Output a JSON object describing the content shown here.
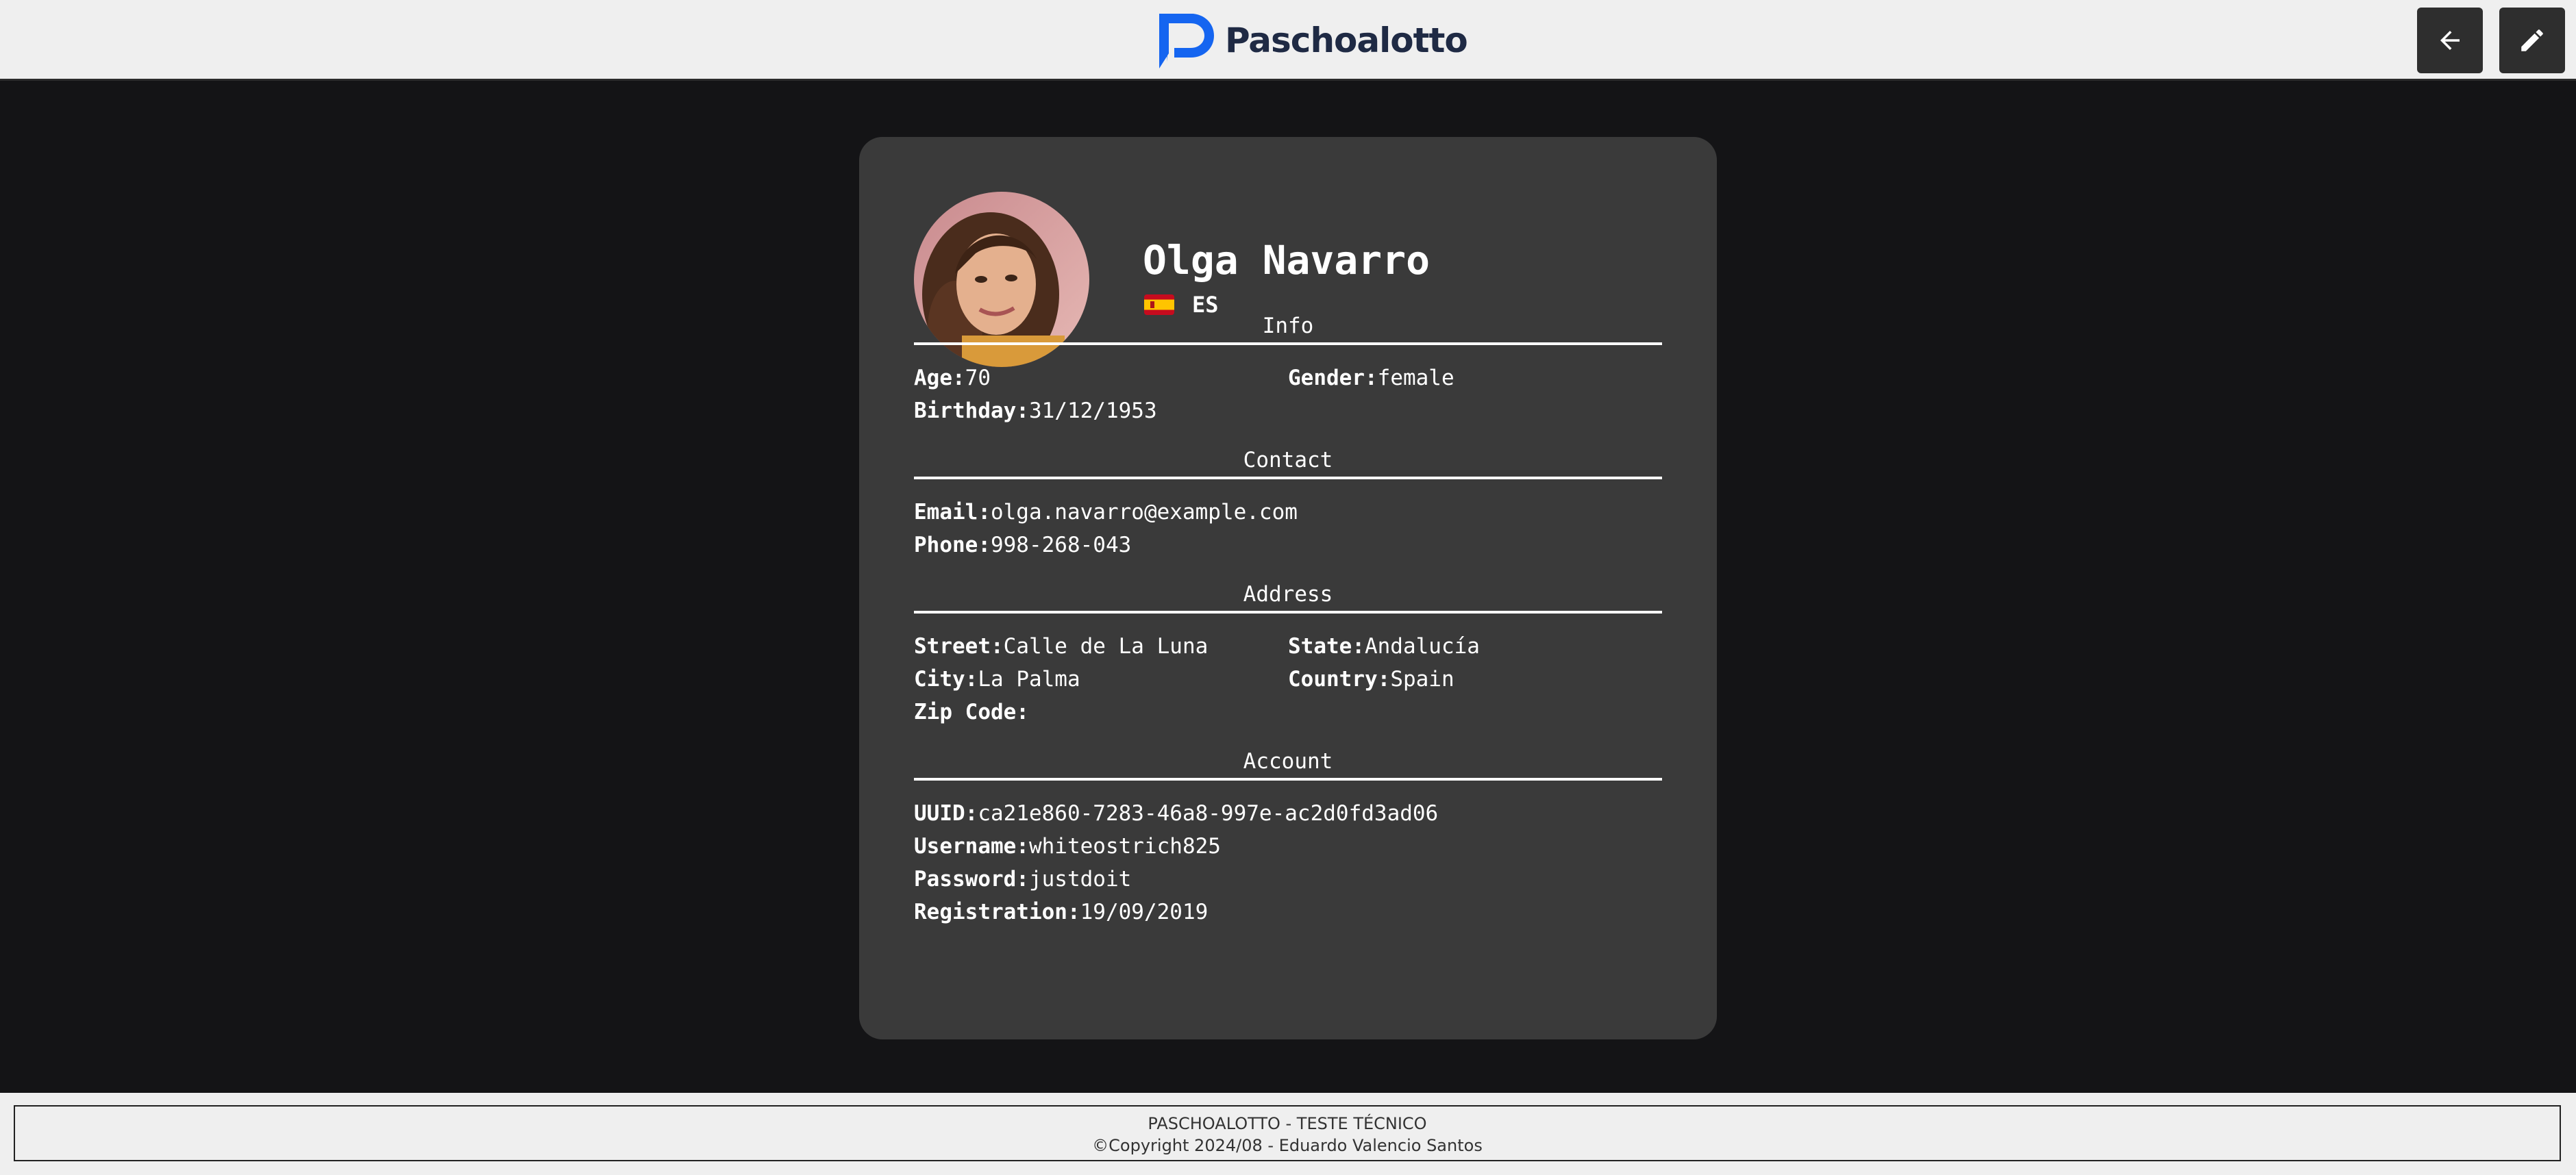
{
  "header": {
    "brand": "Paschoalotto",
    "brand_color": "#1565f0",
    "back_icon": "arrow-left-icon",
    "edit_icon": "pencil-icon"
  },
  "profile": {
    "name": "Olga Navarro",
    "nationality": "ES",
    "flag": "spain-flag-icon",
    "sections": {
      "info": {
        "title": "Info",
        "age_label": "Age:",
        "age": "70",
        "gender_label": "Gender:",
        "gender": "female",
        "birthday_label": "Birthday:",
        "birthday": "31/12/1953"
      },
      "contact": {
        "title": "Contact",
        "email_label": "Email:",
        "email": "olga.navarro@example.com",
        "phone_label": "Phone:",
        "phone": "998-268-043"
      },
      "address": {
        "title": "Address",
        "street_label": "Street:",
        "street": "Calle de La Luna",
        "state_label": "State:",
        "state": "Andalucía",
        "city_label": "City:",
        "city": "La Palma",
        "country_label": "Country:",
        "country": "Spain",
        "zip_label": "Zip Code:",
        "zip": ""
      },
      "account": {
        "title": "Account",
        "uuid_label": "UUID:",
        "uuid": "ca21e860-7283-46a8-997e-ac2d0fd3ad06",
        "username_label": "Username:",
        "username": "whiteostrich825",
        "password_label": "Password:",
        "password": "justdoit",
        "registration_label": "Registration:",
        "registration": "19/09/2019"
      }
    }
  },
  "footer": {
    "line1": "PASCHOALOTTO - TESTE TÉCNICO",
    "line2": "©Copyright 2024/08 - Eduardo Valencio Santos"
  }
}
